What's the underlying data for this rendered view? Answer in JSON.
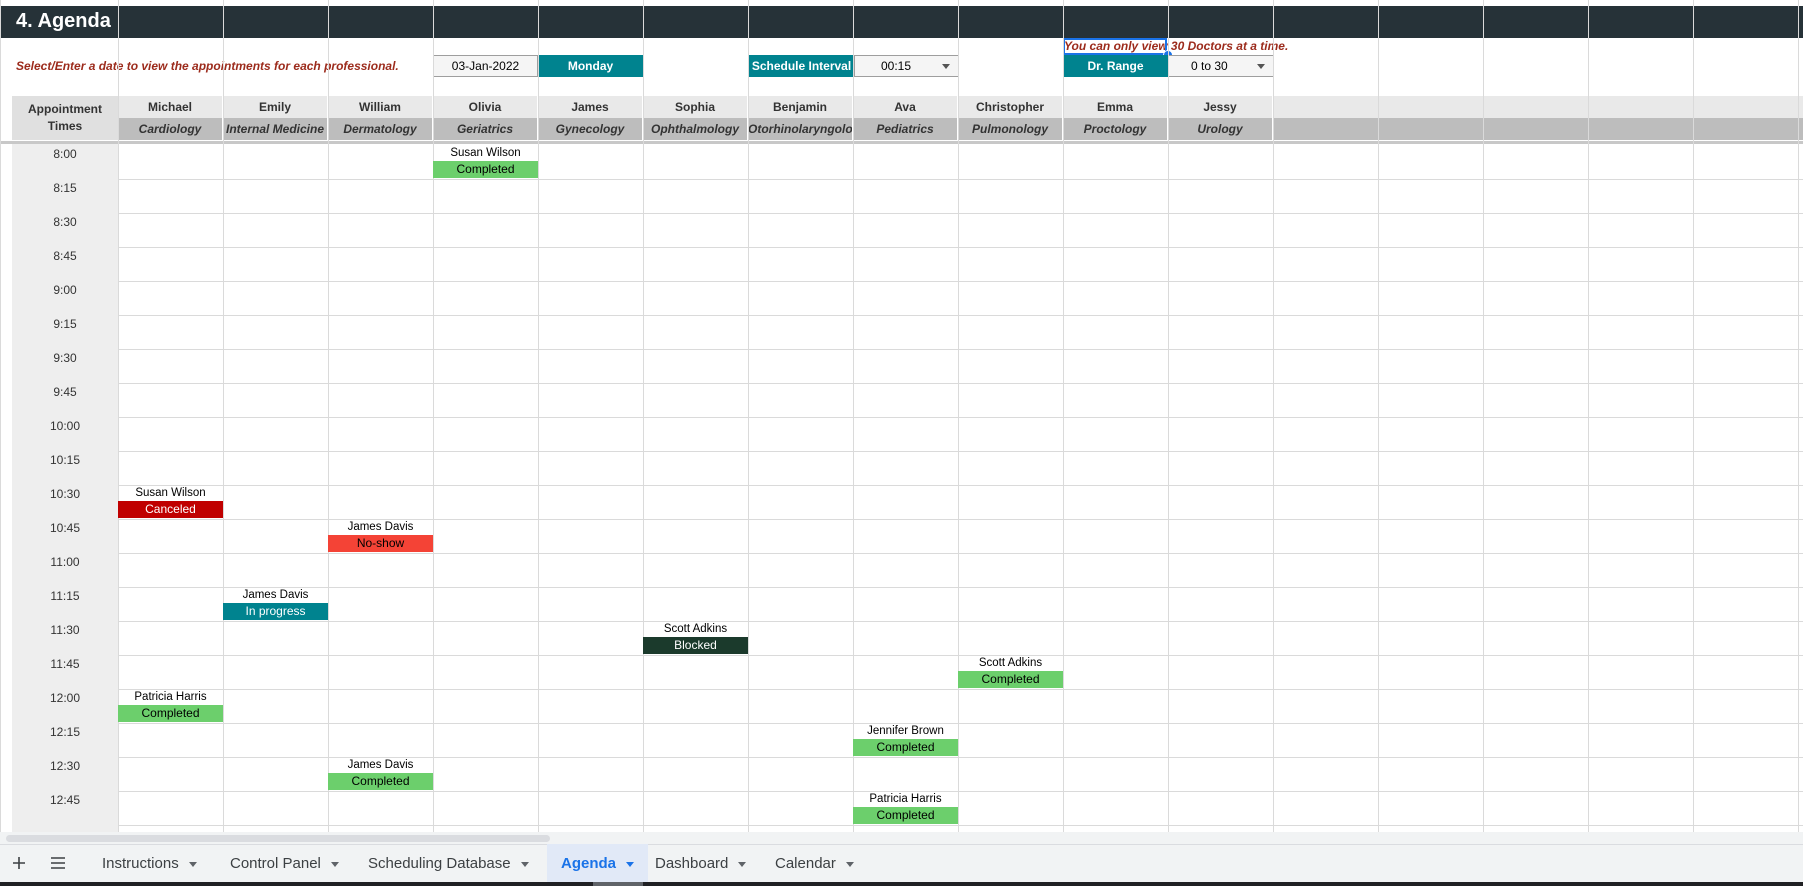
{
  "title": "4. Agenda",
  "instruction": "Select/Enter a date to view the appointments for each professional.",
  "date": "03-Jan-2022",
  "weekday": "Monday",
  "schedule_interval": {
    "label": "Schedule Interval",
    "value": "00:15"
  },
  "dr_range": {
    "label": "Dr. Range",
    "value": "0 to 30"
  },
  "warning": "You can only view 30 Doctors at a time.",
  "times_header": [
    "Appointment",
    "Times"
  ],
  "doctors": [
    {
      "name": "Michael",
      "specialty": "Cardiology"
    },
    {
      "name": "Emily",
      "specialty": "Internal Medicine"
    },
    {
      "name": "William",
      "specialty": "Dermatology"
    },
    {
      "name": "Olivia",
      "specialty": "Geriatrics"
    },
    {
      "name": "James",
      "specialty": "Gynecology"
    },
    {
      "name": "Sophia",
      "specialty": "Ophthalmology"
    },
    {
      "name": "Benjamin",
      "specialty": "Otorhinolaryngology"
    },
    {
      "name": "Ava",
      "specialty": "Pediatrics"
    },
    {
      "name": "Christopher",
      "specialty": "Pulmonology"
    },
    {
      "name": "Emma",
      "specialty": "Proctology"
    },
    {
      "name": "Jessy",
      "specialty": "Urology"
    }
  ],
  "times": [
    "8:00",
    "8:15",
    "8:30",
    "8:45",
    "9:00",
    "9:15",
    "9:30",
    "9:45",
    "10:00",
    "10:15",
    "10:30",
    "10:45",
    "11:00",
    "11:15",
    "11:30",
    "11:45",
    "12:00",
    "12:15",
    "12:30",
    "12:45"
  ],
  "appointments": [
    {
      "doctor": 3,
      "time": "8:00",
      "patient": "Susan Wilson",
      "status": "Completed"
    },
    {
      "doctor": 0,
      "time": "10:30",
      "patient": "Susan Wilson",
      "status": "Canceled"
    },
    {
      "doctor": 2,
      "time": "10:45",
      "patient": "James Davis",
      "status": "No-show"
    },
    {
      "doctor": 1,
      "time": "11:15",
      "patient": "James Davis",
      "status": "In progress"
    },
    {
      "doctor": 5,
      "time": "11:30",
      "patient": "Scott Adkins",
      "status": "Blocked"
    },
    {
      "doctor": 8,
      "time": "11:45",
      "patient": "Scott Adkins",
      "status": "Completed"
    },
    {
      "doctor": 0,
      "time": "12:00",
      "patient": "Patricia Harris",
      "status": "Completed"
    },
    {
      "doctor": 7,
      "time": "12:15",
      "patient": "Jennifer Brown",
      "status": "Completed"
    },
    {
      "doctor": 2,
      "time": "12:30",
      "patient": "James Davis",
      "status": "Completed"
    },
    {
      "doctor": 7,
      "time": "12:45",
      "patient": "Patricia Harris",
      "status": "Completed"
    }
  ],
  "status_colors": {
    "Completed": {
      "bg": "#6ccf6c",
      "fg": "#000000"
    },
    "Canceled": {
      "bg": "#c00000",
      "fg": "#ffffff"
    },
    "No-show": {
      "bg": "#f44336",
      "fg": "#000000"
    },
    "In progress": {
      "bg": "#00838f",
      "fg": "#ffffff"
    },
    "Blocked": {
      "bg": "#1b3a2c",
      "fg": "#ffffff"
    }
  },
  "sheet_tabs": [
    {
      "label": "Instructions",
      "active": false
    },
    {
      "label": "Control Panel",
      "active": false
    },
    {
      "label": "Scheduling Database",
      "active": false
    },
    {
      "label": "Agenda",
      "active": true
    },
    {
      "label": "Dashboard",
      "active": false
    },
    {
      "label": "Calendar",
      "active": false
    }
  ],
  "icons": {
    "add_sheet": "plus-icon",
    "all_sheets": "menu-icon"
  }
}
